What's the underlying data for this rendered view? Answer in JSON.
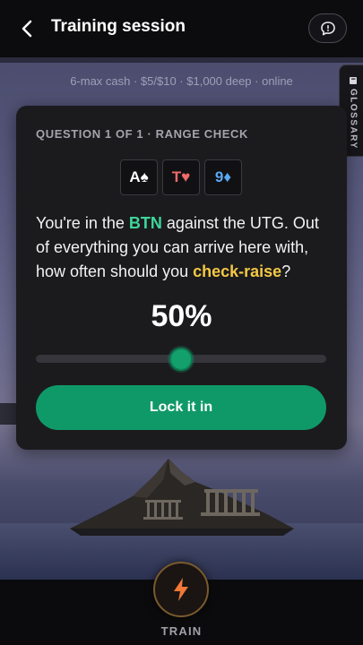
{
  "header": {
    "title": "Training session",
    "back_icon": "chevron-left-icon",
    "chat_icon": "chat-bubble-icon"
  },
  "scene": {
    "subtitle": "6-max cash · $5/$10 · $1,000 deep · online"
  },
  "glossary": {
    "label": "GLOSSARY",
    "icon": "book-icon"
  },
  "question_card": {
    "label": "QUESTION 1 OF 1 · RANGE CHECK",
    "cards": [
      {
        "rank": "A",
        "suit": "♠",
        "color": "#ffffff"
      },
      {
        "rank": "T",
        "suit": "♥",
        "color": "#f26a6a"
      },
      {
        "rank": "9",
        "suit": "♦",
        "color": "#5aa9f5"
      }
    ],
    "question": {
      "part1": "You're in the ",
      "position": "BTN",
      "part2": " against the UTG. Out of everything you can arrive here with, how often should you ",
      "action": "check-raise",
      "part3": "?"
    },
    "percent_text": "50%",
    "slider_value": 0.5,
    "submit_label": "Lock it in"
  },
  "bottom_nav": {
    "train_label": "TRAIN",
    "train_icon": "lightning-bolt-icon"
  },
  "colors": {
    "accent_green": "#109968",
    "highlight_green": "#3fd69a",
    "highlight_yellow": "#f4c843",
    "bolt_orange": "#f07838"
  }
}
